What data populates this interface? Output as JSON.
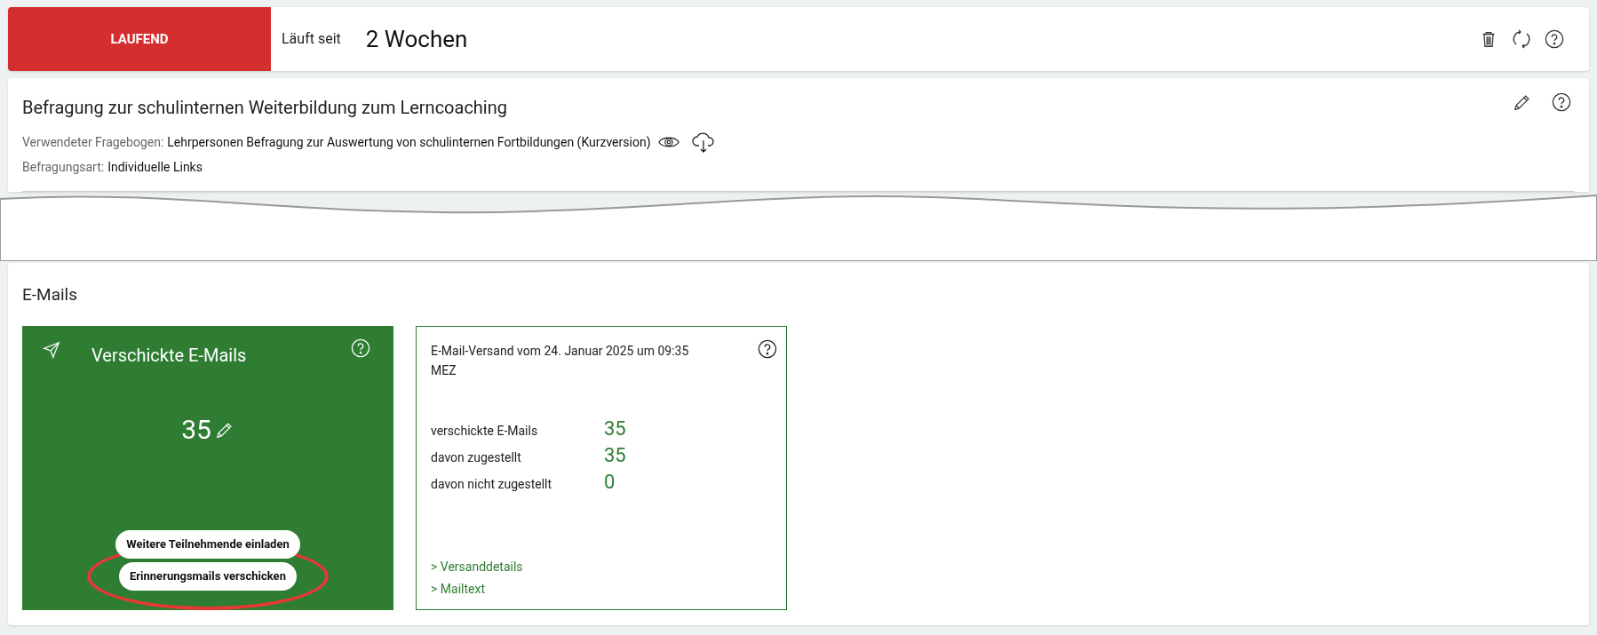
{
  "status_bar": {
    "status": {
      "label": "LAUFEND",
      "kind": "running"
    },
    "since_label": "Läuft seit",
    "since_value": "2 Wochen"
  },
  "survey": {
    "title": "Befragung zur schulinternen Weiterbildung zum Lerncoaching",
    "details": [
      {
        "label": "Verwendeter Fragebogen:",
        "value": "Lehrpersonen Befragung zur Auswertung von schulinternen Fortbildungen (Kurzversion)",
        "kind": "questionnaire"
      },
      {
        "label": "Befragungsart:",
        "value": "Individuelle Links",
        "kind": "plain"
      }
    ]
  },
  "emails": {
    "heading": "E-Mails",
    "sent_card": {
      "title": "Verschickte E-Mails",
      "count": "35",
      "buttons": [
        {
          "label": "Weitere Teilnehmende einladen",
          "highlighted": false
        },
        {
          "label": "Erinnerungsmails verschicken",
          "highlighted": true
        }
      ]
    },
    "dispatch_card": {
      "title": "E-Mail-Versand vom 24. Januar 2025 um 09:35 MEZ",
      "stats": [
        {
          "label": "verschickte E-Mails",
          "value": "35"
        },
        {
          "label": "davon zugestellt",
          "value": "35"
        },
        {
          "label": "davon nicht zugestellt",
          "value": "0"
        }
      ],
      "links": [
        "> Versanddetails",
        "> Mailtext"
      ]
    }
  }
}
